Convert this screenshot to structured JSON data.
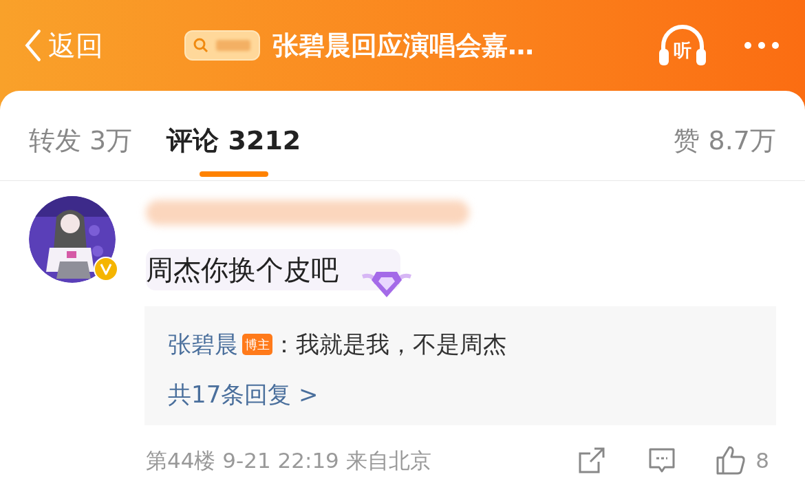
{
  "header": {
    "back": "返回",
    "title": "张碧晨回应演唱会嘉…",
    "listen": "听"
  },
  "tabs": [
    {
      "label": "转发",
      "count": "3万",
      "selected": false
    },
    {
      "label": "评论",
      "count": "3212",
      "selected": true
    }
  ],
  "likes": {
    "label": "赞",
    "count": "8.7万"
  },
  "comments": [
    {
      "text": "周杰你换个皮吧",
      "verified": true,
      "reply": {
        "author": "张碧晨",
        "badge": "博主",
        "text": "：我就是我，不是周杰",
        "more": "共17条回复 >"
      },
      "meta": "第44楼 9-21 22:19 来自北京",
      "like_count": "8"
    }
  ]
}
